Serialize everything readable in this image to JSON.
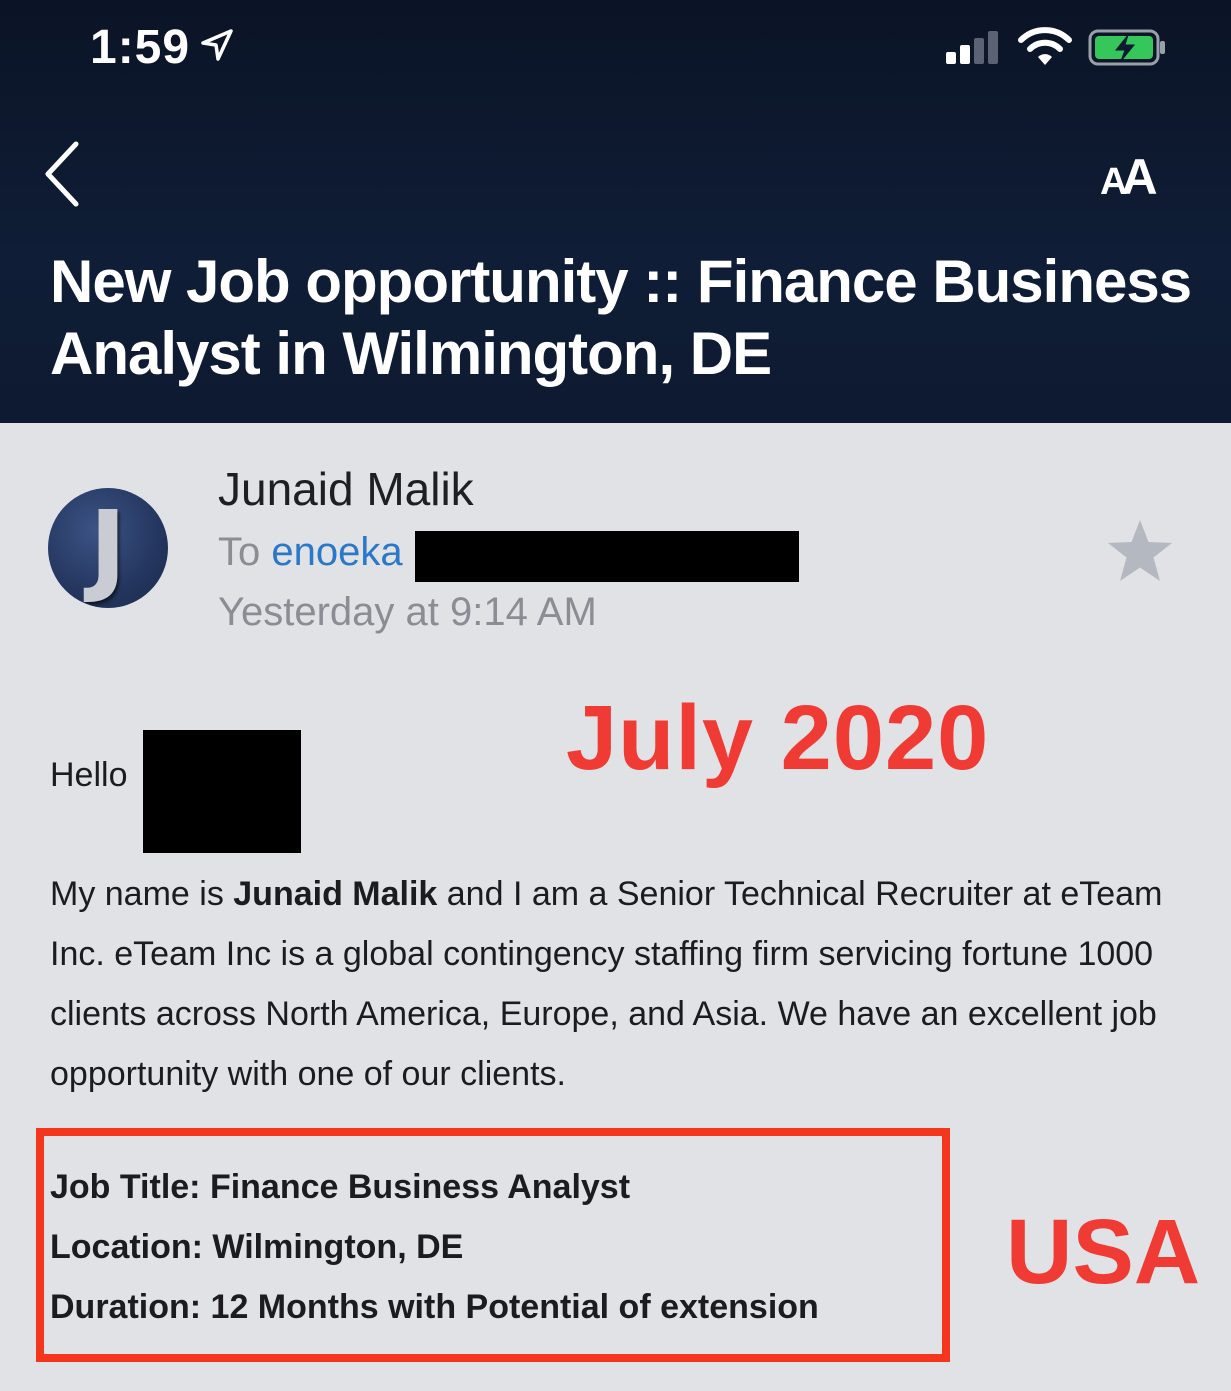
{
  "status_bar": {
    "time": "1:59",
    "icons": [
      "location-arrow-icon",
      "cellular-signal-icon",
      "wifi-icon",
      "battery-charging-icon"
    ]
  },
  "nav": {
    "back_icon": "chevron-left-icon",
    "text_size_label_small": "A",
    "text_size_label_big": "A"
  },
  "email": {
    "subject": "New Job opportunity :: Finance Business Analyst in Wilmington, DE",
    "sender": "Junaid Malik",
    "avatar_letter": "J",
    "to_prefix": "To",
    "to_visible": "enoeka",
    "date": "Yesterday at 9:14 AM",
    "greeting": "Hello",
    "body_pre": "My name is ",
    "body_bold_name": "Junaid Malik",
    "body_post": " and I am a Senior Technical Recruiter at eTeam Inc. eTeam Inc is a global contingency staffing firm servicing fortune 1000 clients across North America, Europe, and Asia. We have an excellent job opportunity with one of our clients.",
    "job_title": "Job Title: Finance Business Analyst",
    "location": "Location: Wilmington, DE",
    "duration": "Duration: 12 Months with Potential of extension"
  },
  "annotations": {
    "date_note": "July 2020",
    "country_note": "USA",
    "color": "#f03b35",
    "box_color": "#f4361d"
  },
  "colors": {
    "header_bg": "#0f1d36",
    "body_bg": "#e1e2e6",
    "link": "#2b78c8",
    "meta_gray": "#8a8d93"
  }
}
